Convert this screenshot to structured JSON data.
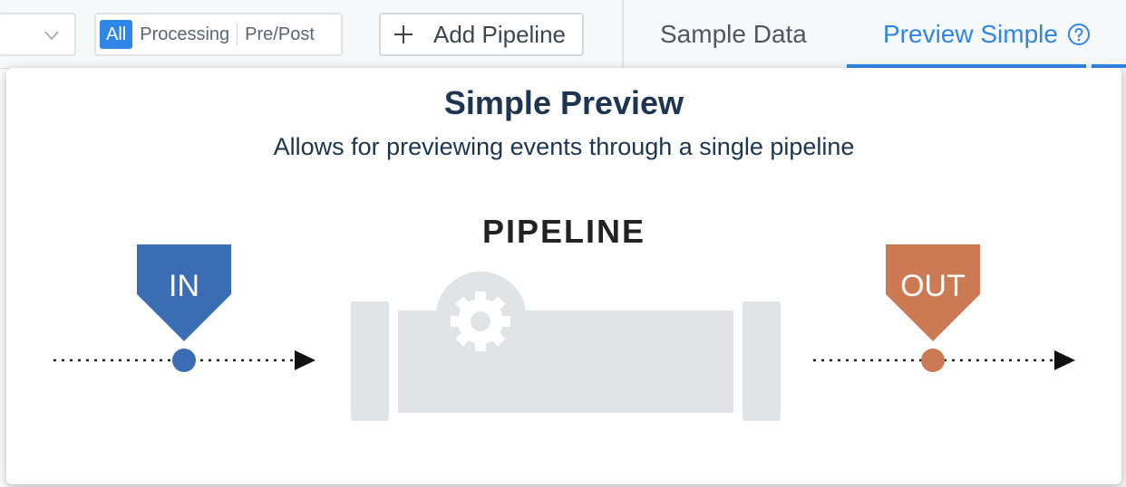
{
  "toolbar": {
    "filter_options": [
      "All",
      "Processing",
      "Pre/Post"
    ],
    "add_pipeline_label": "Add Pipeline"
  },
  "tabs": {
    "sample_data": "Sample Data",
    "preview_simple": "Preview Simple"
  },
  "popover": {
    "title": "Simple Preview",
    "subtitle": "Allows for previewing events through a single pipeline",
    "diagram": {
      "pipeline_label": "PIPELINE",
      "in_label": "IN",
      "out_label": "OUT",
      "in_color": "#3b6db4",
      "out_color": "#cb7a54",
      "pipe_color": "#e1e3e6"
    }
  },
  "colors": {
    "accent": "#2e86e8",
    "heading": "#1d3550"
  },
  "icons": {
    "select_chevron": "chevron-down-icon",
    "add": "plus-icon",
    "help": "question-circle-icon",
    "gear": "gear-icon",
    "arrow": "arrow-right-icon"
  }
}
